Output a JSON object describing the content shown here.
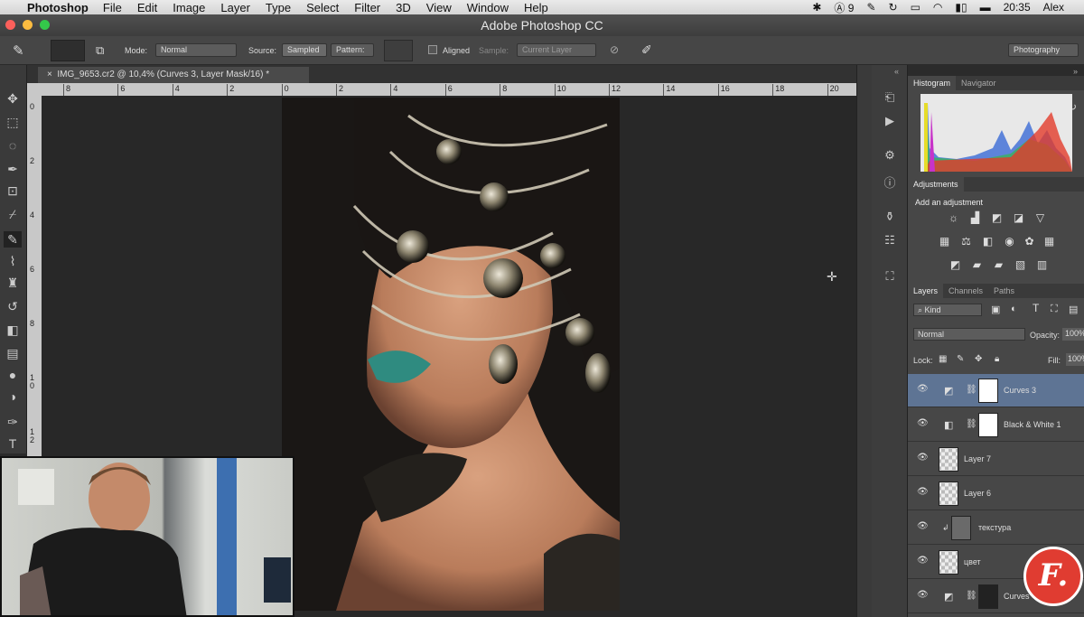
{
  "menubar": {
    "app_name": "Photoshop",
    "items": [
      "File",
      "Edit",
      "Image",
      "Layer",
      "Type",
      "Select",
      "Filter",
      "3D",
      "View",
      "Window",
      "Help"
    ],
    "status_num": "9",
    "clock": "20:35",
    "user": "Alex"
  },
  "window": {
    "title": "Adobe Photoshop CC"
  },
  "options": {
    "mode_label": "Mode:",
    "mode_value": "Normal",
    "source_label": "Source:",
    "sampled": "Sampled",
    "pattern": "Pattern:",
    "aligned": "Aligned",
    "sample_label": "Sample:",
    "sample_value": "Current Layer",
    "workspace": "Photography"
  },
  "document": {
    "tab_title": "IMG_9653.cr2 @ 10,4% (Curves 3, Layer Mask/16) *"
  },
  "ruler": {
    "h_ticks": [
      "8",
      "6",
      "4",
      "2",
      "0",
      "2",
      "4",
      "6",
      "8",
      "10",
      "12",
      "14",
      "16",
      "18",
      "20"
    ],
    "v_ticks": [
      "0",
      "2",
      "4",
      "6",
      "8",
      "1\n0",
      "1\n2"
    ]
  },
  "panels": {
    "histogram_tabs": [
      "Histogram",
      "Navigator"
    ],
    "adjustments_tab": "Adjustments",
    "add_adjustment": "Add an adjustment",
    "layers_tabs": [
      "Layers",
      "Channels",
      "Paths"
    ],
    "kind": "Kind",
    "blend": "Normal",
    "opacity_label": "Opacity:",
    "opacity_value": "100%",
    "lock_label": "Lock:",
    "fill_label": "Fill:",
    "fill_value": "100%"
  },
  "layers": [
    {
      "name": "Curves 3",
      "selected": true,
      "type": "curves"
    },
    {
      "name": "Black & White 1",
      "selected": false,
      "type": "bw"
    },
    {
      "name": "Layer 7",
      "selected": false,
      "type": "pixel"
    },
    {
      "name": "Layer 6",
      "selected": false,
      "type": "pixel"
    },
    {
      "name": "текстура",
      "selected": false,
      "type": "gray"
    },
    {
      "name": "цвет",
      "selected": false,
      "type": "pixel"
    },
    {
      "name": "Curves",
      "selected": false,
      "type": "curves-mask"
    }
  ],
  "logo": {
    "letter": "F."
  },
  "colors": {
    "accent_selected": "#5e7494",
    "panel_bg": "#474747",
    "logo_red": "#e03c31"
  }
}
